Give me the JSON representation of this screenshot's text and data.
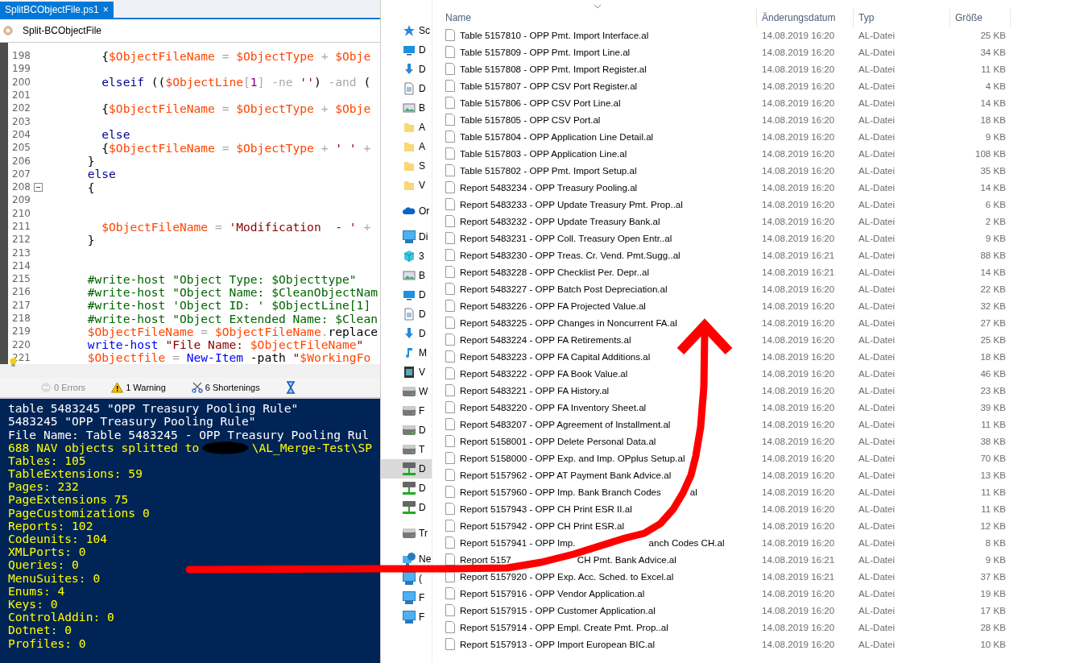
{
  "editor": {
    "tabs": [
      {
        "label": "SplitBCObjectFile.ps1",
        "close": "×",
        "selected": true
      }
    ],
    "function_bar": {
      "label": "Split-BCObjectFile"
    },
    "lines": [
      {
        "number": "198",
        "tokens": [
          {
            "kind": "plain",
            "text": "        {"
          },
          {
            "kind": "variable",
            "text": "$ObjectFileName"
          },
          {
            "kind": "operator",
            "text": " = "
          },
          {
            "kind": "variable",
            "text": "$ObjectType"
          },
          {
            "kind": "operator",
            "text": " + "
          },
          {
            "kind": "variable",
            "text": "$Obje"
          }
        ]
      },
      {
        "number": "199"
      },
      {
        "number": "200",
        "tokens": [
          {
            "kind": "keyword",
            "text": "        elseif"
          },
          {
            "kind": "plain",
            "text": " (("
          },
          {
            "kind": "variable",
            "text": "$ObjectLine"
          },
          {
            "kind": "operator",
            "text": "["
          },
          {
            "kind": "number",
            "text": "1"
          },
          {
            "kind": "operator",
            "text": "] -ne "
          },
          {
            "kind": "string",
            "text": "''"
          },
          {
            "kind": "plain",
            "text": ") "
          },
          {
            "kind": "operator",
            "text": "-and"
          },
          {
            "kind": "plain",
            "text": " ("
          }
        ]
      },
      {
        "number": "201"
      },
      {
        "number": "202",
        "tokens": [
          {
            "kind": "plain",
            "text": "        {"
          },
          {
            "kind": "variable",
            "text": "$ObjectFileName"
          },
          {
            "kind": "operator",
            "text": " = "
          },
          {
            "kind": "variable",
            "text": "$ObjectType"
          },
          {
            "kind": "operator",
            "text": " + "
          },
          {
            "kind": "variable",
            "text": "$Obje"
          }
        ]
      },
      {
        "number": "203"
      },
      {
        "number": "204",
        "tokens": [
          {
            "kind": "keyword",
            "text": "        else"
          }
        ]
      },
      {
        "number": "205",
        "tokens": [
          {
            "kind": "plain",
            "text": "        {"
          },
          {
            "kind": "variable",
            "text": "$ObjectFileName"
          },
          {
            "kind": "operator",
            "text": " = "
          },
          {
            "kind": "variable",
            "text": "$ObjectType"
          },
          {
            "kind": "operator",
            "text": " + "
          },
          {
            "kind": "string",
            "text": "' '"
          },
          {
            "kind": "operator",
            "text": " +"
          }
        ]
      },
      {
        "number": "206",
        "tokens": [
          {
            "kind": "plain",
            "text": "      }"
          }
        ]
      },
      {
        "number": "207",
        "tokens": [
          {
            "kind": "keyword",
            "text": "      else"
          }
        ]
      },
      {
        "number": "208",
        "fold": true,
        "tokens": [
          {
            "kind": "plain",
            "text": "      {"
          }
        ]
      },
      {
        "number": "209"
      },
      {
        "number": "210"
      },
      {
        "number": "211",
        "tokens": [
          {
            "kind": "variable",
            "text": "        $ObjectFileName"
          },
          {
            "kind": "operator",
            "text": " = "
          },
          {
            "kind": "string",
            "text": "'Modification  - '"
          },
          {
            "kind": "operator",
            "text": " +"
          }
        ]
      },
      {
        "number": "212",
        "tokens": [
          {
            "kind": "plain",
            "text": "      }"
          }
        ]
      },
      {
        "number": "213"
      },
      {
        "number": "214"
      },
      {
        "number": "215",
        "tokens": [
          {
            "kind": "comment",
            "text": "      #write-host \"Object Type: $Objecttype\""
          }
        ]
      },
      {
        "number": "216",
        "tokens": [
          {
            "kind": "comment",
            "text": "      #write-host \"Object Name: $CleanObjectNam"
          }
        ]
      },
      {
        "number": "217",
        "tokens": [
          {
            "kind": "comment",
            "text": "      #write-host 'Object ID: ' $ObjectLine[1]"
          }
        ]
      },
      {
        "number": "218",
        "tokens": [
          {
            "kind": "comment",
            "text": "      #write-host \"Object Extended Name: $Clean"
          }
        ]
      },
      {
        "number": "219",
        "tokens": [
          {
            "kind": "variable",
            "text": "      $ObjectFileName"
          },
          {
            "kind": "operator",
            "text": " = "
          },
          {
            "kind": "variable",
            "text": "$ObjectFileName"
          },
          {
            "kind": "operator",
            "text": "."
          },
          {
            "kind": "plain",
            "text": "replace"
          }
        ]
      },
      {
        "number": "220",
        "tokens": [
          {
            "kind": "command",
            "text": "      write-host "
          },
          {
            "kind": "string",
            "text": "\"File Name: "
          },
          {
            "kind": "variable",
            "text": "$ObjectFileName"
          },
          {
            "kind": "string",
            "text": "\""
          }
        ]
      },
      {
        "number": "221",
        "bulb": true,
        "tokens": [
          {
            "kind": "variable",
            "text": "      $Objectfile"
          },
          {
            "kind": "operator",
            "text": " = "
          },
          {
            "kind": "command",
            "text": "New-Item"
          },
          {
            "kind": "plain",
            "text": " -path "
          },
          {
            "kind": "string",
            "text": "\""
          },
          {
            "kind": "variable",
            "text": "$WorkingFo"
          }
        ]
      }
    ]
  },
  "status_bar": [
    {
      "kind": "errors",
      "label": "0 Errors",
      "disabled": true
    },
    {
      "kind": "warnings",
      "label": "1 Warning",
      "disabled": false
    },
    {
      "kind": "shortenings",
      "label": "6 Shortenings",
      "disabled": false
    }
  ],
  "console": [
    {
      "text": "table 5483245 \"OPP Treasury Pooling Rule\"",
      "color": "#ffffff"
    },
    {
      "text": "5483245 \"OPP Treasury Pooling Rule\"",
      "color": "#ffffff"
    },
    {
      "text": "File Name: Table 5483245 - OPP Treasury Pooling Rul",
      "color": "#ffffff"
    },
    {
      "text": "688 NAV objects splitted to",
      "redacted": true,
      "after": "\\AL_Merge-Test\\SP",
      "color": "#ffff00"
    },
    {
      "text": "Tables: 105",
      "color": "#ffff00"
    },
    {
      "text": "TableExtensions: 59",
      "color": "#ffff00"
    },
    {
      "text": "Pages: 232",
      "color": "#ffff00"
    },
    {
      "text": "PageExtensions 75",
      "color": "#ffff00"
    },
    {
      "text": "PageCustomizations 0",
      "color": "#ffff00"
    },
    {
      "text": "Reports: 102",
      "color": "#ffff00"
    },
    {
      "text": "Codeunits: 104",
      "color": "#ffff00"
    },
    {
      "text": "XMLPorts: 0",
      "color": "#ffff00"
    },
    {
      "text": "Queries: 0",
      "color": "#ffff00"
    },
    {
      "text": "MenuSuites: 0",
      "color": "#ffff00"
    },
    {
      "text": "Enums: 4",
      "color": "#ffff00"
    },
    {
      "text": "Keys: 0",
      "color": "#ffff00"
    },
    {
      "text": "ControlAddin: 0",
      "color": "#ffff00"
    },
    {
      "text": "Dotnet: 0",
      "color": "#ffff00"
    },
    {
      "text": "Profiles: 0",
      "color": "#ffff00"
    }
  ],
  "explorer": {
    "sidebar": [
      {
        "items": [
          {
            "label": "Sc",
            "kind": "star",
            "selected": false
          },
          {
            "label": "D",
            "kind": "desktop",
            "selected": false
          },
          {
            "label": "D",
            "kind": "download",
            "selected": false
          },
          {
            "label": "D",
            "kind": "document",
            "selected": false
          },
          {
            "label": "B",
            "kind": "image",
            "selected": false
          },
          {
            "label": "A",
            "kind": "folder",
            "selected": false
          },
          {
            "label": "A",
            "kind": "folder",
            "selected": false
          },
          {
            "label": "S",
            "kind": "folder",
            "selected": false
          },
          {
            "label": "V",
            "kind": "folder",
            "selected": false
          }
        ]
      },
      {
        "items": [
          {
            "label": "Or",
            "kind": "cloud",
            "selected": false
          }
        ]
      },
      {
        "items": [
          {
            "label": "Di",
            "kind": "pc",
            "selected": false
          },
          {
            "label": "3",
            "kind": "cube",
            "selected": false
          },
          {
            "label": "B",
            "kind": "image",
            "selected": false
          },
          {
            "label": "D",
            "kind": "desktop",
            "selected": false
          },
          {
            "label": "D",
            "kind": "document",
            "selected": false
          },
          {
            "label": "D",
            "kind": "download",
            "selected": false
          },
          {
            "label": "M",
            "kind": "music",
            "selected": false
          },
          {
            "label": "V",
            "kind": "video",
            "selected": false
          },
          {
            "label": "W",
            "kind": "drive",
            "selected": false
          },
          {
            "label": "F",
            "kind": "drive",
            "selected": false
          },
          {
            "label": "D",
            "kind": "drive",
            "selected": false
          },
          {
            "label": "T",
            "kind": "drive",
            "selected": false
          },
          {
            "label": "D",
            "kind": "netdrive",
            "selected": true
          },
          {
            "label": "D",
            "kind": "netdrive",
            "selected": false
          },
          {
            "label": "D",
            "kind": "netdrive",
            "selected": false
          }
        ]
      },
      {
        "items": [
          {
            "label": "Tr",
            "kind": "drive",
            "selected": false
          }
        ]
      },
      {
        "items": [
          {
            "label": "Ne",
            "kind": "network",
            "selected": false
          },
          {
            "label": "(",
            "kind": "monitor",
            "selected": false
          },
          {
            "label": "F",
            "kind": "monitor",
            "selected": false
          },
          {
            "label": "F",
            "kind": "monitor",
            "selected": false
          }
        ]
      }
    ],
    "columns": [
      "Name",
      "Änderungsdatum",
      "Typ",
      "Größe"
    ],
    "files": [
      {
        "name": "Table 5157810 - OPP Pmt. Import Interface.al",
        "date": "14.08.2019 16:20",
        "type": "AL-Datei",
        "size": "25 KB"
      },
      {
        "name": "Table 5157809 - OPP Pmt. Import Line.al",
        "date": "14.08.2019 16:20",
        "type": "AL-Datei",
        "size": "34 KB"
      },
      {
        "name": "Table 5157808 - OPP Pmt. Import Register.al",
        "date": "14.08.2019 16:20",
        "type": "AL-Datei",
        "size": "11 KB"
      },
      {
        "name": "Table 5157807 - OPP CSV Port Register.al",
        "date": "14.08.2019 16:20",
        "type": "AL-Datei",
        "size": "4 KB"
      },
      {
        "name": "Table 5157806 - OPP CSV Port Line.al",
        "date": "14.08.2019 16:20",
        "type": "AL-Datei",
        "size": "14 KB"
      },
      {
        "name": "Table 5157805 - OPP CSV Port.al",
        "date": "14.08.2019 16:20",
        "type": "AL-Datei",
        "size": "18 KB"
      },
      {
        "name": "Table 5157804 - OPP Application Line Detail.al",
        "date": "14.08.2019 16:20",
        "type": "AL-Datei",
        "size": "9 KB"
      },
      {
        "name": "Table 5157803 - OPP Application Line.al",
        "date": "14.08.2019 16:20",
        "type": "AL-Datei",
        "size": "108 KB"
      },
      {
        "name": "Table 5157802 - OPP Pmt. Import Setup.al",
        "date": "14.08.2019 16:20",
        "type": "AL-Datei",
        "size": "35 KB"
      },
      {
        "name": "Report 5483234 - OPP Treasury Pooling.al",
        "date": "14.08.2019 16:20",
        "type": "AL-Datei",
        "size": "14 KB"
      },
      {
        "name": "Report 5483233 - OPP Update Treasury Pmt. Prop..al",
        "date": "14.08.2019 16:20",
        "type": "AL-Datei",
        "size": "6 KB"
      },
      {
        "name": "Report 5483232 - OPP Update Treasury Bank.al",
        "date": "14.08.2019 16:20",
        "type": "AL-Datei",
        "size": "2 KB"
      },
      {
        "name": "Report 5483231 - OPP Coll. Treasury Open Entr..al",
        "date": "14.08.2019 16:20",
        "type": "AL-Datei",
        "size": "9 KB"
      },
      {
        "name": "Report 5483230 - OPP Treas. Cr. Vend. Pmt.Sugg..al",
        "date": "14.08.2019 16:21",
        "type": "AL-Datei",
        "size": "88 KB"
      },
      {
        "name": "Report 5483228 - OPP Checklist Per. Depr..al",
        "date": "14.08.2019 16:21",
        "type": "AL-Datei",
        "size": "14 KB"
      },
      {
        "name": "Report 5483227 - OPP Batch Post Depreciation.al",
        "date": "14.08.2019 16:20",
        "type": "AL-Datei",
        "size": "22 KB"
      },
      {
        "name": "Report 5483226 - OPP FA Projected Value.al",
        "date": "14.08.2019 16:20",
        "type": "AL-Datei",
        "size": "32 KB"
      },
      {
        "name": "Report 5483225 - OPP Changes in Noncurrent FA.al",
        "date": "14.08.2019 16:20",
        "type": "AL-Datei",
        "size": "27 KB"
      },
      {
        "name": "Report 5483224 - OPP FA Retirements.al",
        "date": "14.08.2019 16:20",
        "type": "AL-Datei",
        "size": "25 KB"
      },
      {
        "name": "Report 5483223 - OPP FA Capital Additions.al",
        "date": "14.08.2019 16:20",
        "type": "AL-Datei",
        "size": "18 KB"
      },
      {
        "name": "Report 5483222 - OPP FA Book Value.al",
        "date": "14.08.2019 16:20",
        "type": "AL-Datei",
        "size": "46 KB"
      },
      {
        "name": "Report 5483221 - OPP FA History.al",
        "date": "14.08.2019 16:20",
        "type": "AL-Datei",
        "size": "23 KB"
      },
      {
        "name": "Report 5483220 - OPP FA Inventory Sheet.al",
        "date": "14.08.2019 16:20",
        "type": "AL-Datei",
        "size": "39 KB"
      },
      {
        "name": "Report 5483207 - OPP Agreement of Installment.al",
        "date": "14.08.2019 16:20",
        "type": "AL-Datei",
        "size": "11 KB"
      },
      {
        "name": "Report 5158001 - OPP Delete Personal Data.al",
        "date": "14.08.2019 16:20",
        "type": "AL-Datei",
        "size": "38 KB"
      },
      {
        "name": "Report 5158000 - OPP Exp. and Imp. OPplus Setup.al",
        "date": "14.08.2019 16:20",
        "type": "AL-Datei",
        "size": "70 KB"
      },
      {
        "name": "Report 5157962 - OPP AT Payment Bank Advice.al",
        "date": "14.08.2019 16:20",
        "type": "AL-Datei",
        "size": "13 KB"
      },
      {
        "name": "Report 5157960 - OPP Imp. Bank Branch Codes",
        "name_end": "al",
        "kind": "short",
        "date": "14.08.2019 16:20",
        "type": "AL-Datei",
        "size": "11 KB"
      },
      {
        "name": "Report 5157943 - OPP CH Print ESR II.al",
        "date": "14.08.2019 16:20",
        "type": "AL-Datei",
        "size": "11 KB"
      },
      {
        "name": "Report 5157942 - OPP CH Print ESR.al",
        "date": "14.08.2019 16:20",
        "type": "AL-Datei",
        "size": "12 KB"
      },
      {
        "name": "Report 5157941 - OPP Imp.",
        "name_end": "anch Codes CH.al",
        "kind": "medium",
        "date": "14.08.2019 16:20",
        "type": "AL-Datei",
        "size": "8 KB"
      },
      {
        "name": "Report 5157",
        "name_end": "CH Pmt. Bank Advice.al",
        "kind": "long",
        "date": "14.08.2019 16:21",
        "type": "AL-Datei",
        "size": "9 KB"
      },
      {
        "name": "Report 5157920 - OPP Exp. Acc. Sched. to Excel.al",
        "date": "14.08.2019 16:21",
        "type": "AL-Datei",
        "size": "37 KB"
      },
      {
        "name": "Report 5157916 - OPP Vendor Application.al",
        "date": "14.08.2019 16:20",
        "type": "AL-Datei",
        "size": "19 KB"
      },
      {
        "name": "Report 5157915 - OPP Customer Application.al",
        "date": "14.08.2019 16:20",
        "type": "AL-Datei",
        "size": "17 KB"
      },
      {
        "name": "Report 5157914 - OPP Empl. Create Pmt. Prop..al",
        "date": "14.08.2019 16:20",
        "type": "AL-Datei",
        "size": "28 KB"
      },
      {
        "name": "Report 5157913 - OPP Import European BIC.al",
        "date": "14.08.2019 16:20",
        "type": "AL-Datei",
        "size": "10 KB"
      }
    ]
  }
}
